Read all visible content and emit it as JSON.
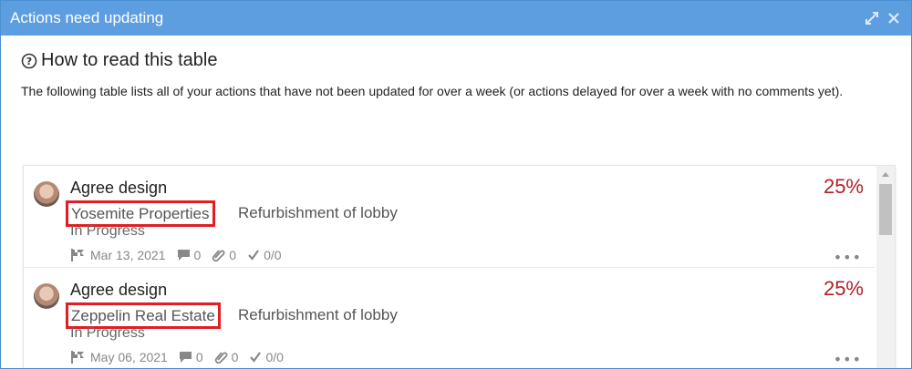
{
  "dialog": {
    "title": "Actions need updating"
  },
  "header_icons": [
    "expand-icon",
    "close-icon"
  ],
  "help": {
    "title": "How to read this table",
    "description": "The following table lists all of your actions that have not been updated for over a week (or actions delayed for over a week with no comments yet)."
  },
  "actions": [
    {
      "title": "Agree design",
      "company": "Yosemite Properties",
      "project": "Refurbishment of lobby",
      "status": "In Progress",
      "percent": "25%",
      "date": "Mar 13, 2021",
      "comments": "0",
      "attachments": "0",
      "checklist": "0/0"
    },
    {
      "title": "Agree design",
      "company": "Zeppelin Real Estate",
      "project": "Refurbishment of lobby",
      "status": "In Progress",
      "percent": "25%",
      "date": "May 06, 2021",
      "comments": "0",
      "attachments": "0",
      "checklist": "0/0"
    }
  ],
  "colors": {
    "header": "#5d9ee0",
    "percent": "#b21f27",
    "highlight": "#e01e23"
  }
}
